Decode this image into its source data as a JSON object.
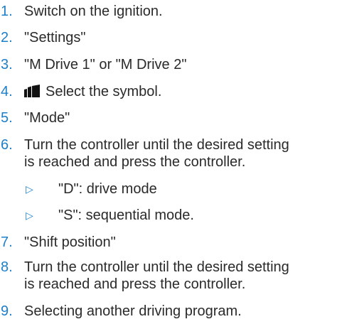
{
  "steps": [
    {
      "num": "1.",
      "text": "Switch on the ignition."
    },
    {
      "num": "2.",
      "text": "\"Settings\""
    },
    {
      "num": "3.",
      "text": "\"M Drive 1\" or \"M Drive 2\""
    },
    {
      "num": "4.",
      "text": "Select the symbol.",
      "icon": "drive-program-icon"
    },
    {
      "num": "5.",
      "text": "\"Mode\""
    },
    {
      "num": "6.",
      "text": "Turn the controller until the desired setting",
      "text2": "is reached and press the controller."
    },
    {
      "num": "7.",
      "text": "\"Shift position\""
    },
    {
      "num": "8.",
      "text": "Turn the controller until the desired setting",
      "text2": "is reached and press the controller."
    },
    {
      "num": "9.",
      "text": "Selecting another driving program."
    }
  ],
  "substeps": [
    {
      "marker": "▷",
      "text": "\"D\": drive mode"
    },
    {
      "marker": "▷",
      "text": "\"S\": sequential mode."
    }
  ],
  "colors": {
    "number": "#1e7fc9",
    "text": "#2a2a2a"
  }
}
